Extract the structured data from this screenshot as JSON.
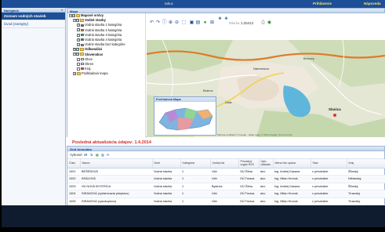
{
  "topbar": {
    "title": "Iabuc",
    "login": "Prihlásenie",
    "help": "Nápoveda"
  },
  "nav": {
    "header": "Navigácia",
    "items": [
      {
        "label": "Zoznam vodných stavieb",
        "active": true
      },
      {
        "label": "Úvod (zaregtry)",
        "active": false
      }
    ]
  },
  "map_panel": {
    "header": "Mapa",
    "layers": [
      {
        "label": "Mapové vrstvy",
        "indent": 0,
        "bold": true,
        "toggle": "−",
        "checked": true,
        "kind": "folder"
      },
      {
        "label": "Vodné stavby",
        "indent": 1,
        "bold": true,
        "toggle": "−",
        "checked": true,
        "kind": "folder"
      },
      {
        "label": "Vodná stavba 1 kategória",
        "indent": 2,
        "checked": true,
        "kind": "legend",
        "color": "#c0392b"
      },
      {
        "label": "Vodná stavba 2 kategória",
        "indent": 2,
        "checked": true,
        "kind": "legend",
        "color": "#e67e22"
      },
      {
        "label": "Vodná stavba 3 kategória",
        "indent": 2,
        "checked": true,
        "kind": "legend",
        "color": "#27ae60"
      },
      {
        "label": "Vodná stavba 4 kategória",
        "indent": 2,
        "checked": true,
        "kind": "legend",
        "color": "#2980b9"
      },
      {
        "label": "Vodné stavba bez kategórie",
        "indent": 2,
        "checked": true,
        "kind": "legend",
        "color": "#7f8c8d"
      },
      {
        "label": "Odkanalizá",
        "indent": 1,
        "bold": true,
        "toggle": "+",
        "checked": true,
        "kind": "folder"
      },
      {
        "label": "Slovenskos",
        "indent": 1,
        "bold": true,
        "toggle": "−",
        "checked": true,
        "kind": "folder"
      },
      {
        "label": "Obce",
        "indent": 2,
        "checked": false,
        "kind": "legend",
        "color": "#ffffff"
      },
      {
        "label": "Okres",
        "indent": 2,
        "checked": false,
        "kind": "legend",
        "color": "#ffffff"
      },
      {
        "label": "Kraj",
        "indent": 2,
        "checked": false,
        "kind": "legend",
        "color": "#d04545"
      },
      {
        "label": "Podkladová mapa",
        "indent": 1,
        "checked": true,
        "kind": "folder"
      }
    ],
    "toolbar": {
      "icons": [
        "undo-icon",
        "redo-icon",
        "info-icon",
        "zoom-in-icon",
        "zoom-out-icon",
        "zoom-box-icon",
        "select-icon",
        "layers-icon",
        "globe-icon",
        "measure-icon",
        "pan-icon",
        "move-icon"
      ],
      "scale_label": "Mierka",
      "scale_value": "1:25412"
    },
    "map": {
      "labels": [
        "Bobrov",
        "Námestovo",
        "Slanica",
        "Ústie",
        "Brezovy"
      ],
      "overview_title": "Prehľadová Mapa",
      "copyright": "Mapové podklady © Google · údaje mapy © 2014 Google, Terms of Use"
    }
  },
  "update_line": "Posledná aktualizácia údajov: 1.4.2014",
  "form_panel": {
    "header": "Grid formulára",
    "toolbar": {
      "label": "Vybrané: 1",
      "icons": [
        "filter-icon",
        "sort-icon",
        "export-icon",
        "columns-icon",
        "refresh-icon"
      ]
    },
    "columns": [
      "Číslo",
      "Názov",
      "Druh",
      "Kategória",
      "Vodný tok",
      "Príslušný orgán ŠVS",
      "Vyto. dokladu",
      "Meno/ kto spáva",
      "Stav",
      "Kraj"
    ],
    "rows": [
      [
        "1001",
        "BEŠEŇOVÁ",
        "Vodná stavba",
        "1",
        "Váh",
        "OÚ Žilina",
        "áno",
        "Ing. Andrej Kasana",
        "v prevádzke",
        "Žilinský"
      ],
      [
        "1002",
        "KRÁĽOVÁ",
        "Vodná stavba",
        "1",
        "Váh",
        "OÚ Trnava",
        "áno",
        "Ing. Milan Hronok",
        "v prevádzke",
        "Nitriansky"
      ],
      [
        "1003",
        "VN NOVÁ BYSTRICA",
        "Vodná stavba",
        "1",
        "Bystrica",
        "OÚ Žilina",
        "áno",
        "Ing. Andrej Kasana",
        "v prevádzke",
        "Žilinský"
      ],
      [
        "1004",
        "SIRANOVÁ (vyčisťovacia prieplavu)",
        "Vodná stavba",
        "1",
        "Váh",
        "OÚ Trnava",
        "áno",
        "Ing. Milan Hronok",
        "v prevádzke",
        "Trnavský"
      ],
      [
        "1005",
        "SIRANOVÁ (vysokoplovo)",
        "Vodná stavba",
        "1",
        "Váh",
        "OÚ Trnava",
        "áno",
        "Ing. Milan Hronok",
        "v prevádzke",
        "Trnavský"
      ]
    ]
  },
  "colors": {
    "brand": "#1d4f96",
    "accent_red": "#d42a2a",
    "panel_border": "#9fb6d6",
    "title_yellow": "#ffe259"
  }
}
